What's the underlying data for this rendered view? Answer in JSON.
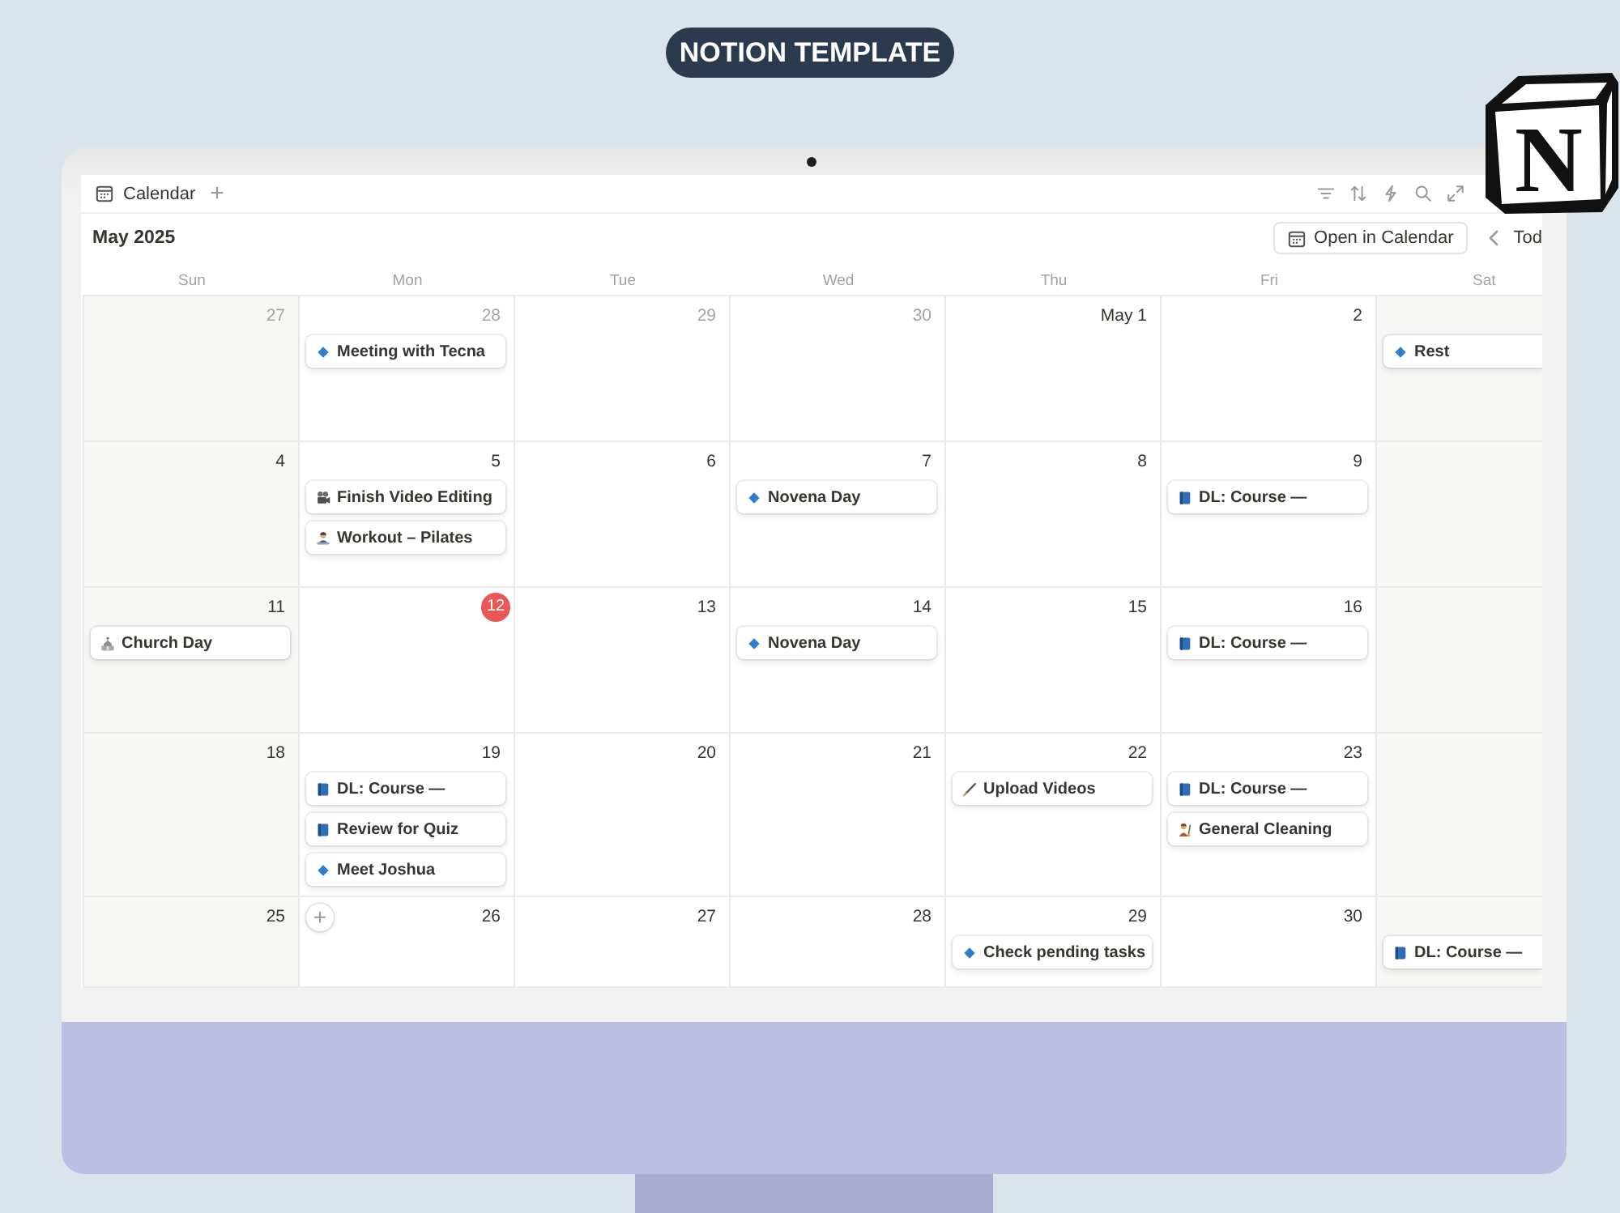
{
  "badge": {
    "label": "NOTION TEMPLATE"
  },
  "logo": {
    "letter": "N"
  },
  "app": {
    "view_tab": "Calendar",
    "add_view": "+",
    "month": "May 2025",
    "open_button": "Open in Calendar",
    "today_button": "Tod"
  },
  "weekdays": [
    "Sun",
    "Mon",
    "Tue",
    "Wed",
    "Thu",
    "Fri",
    "Sat"
  ],
  "weeks": [
    {
      "days": [
        {
          "date": "27",
          "muted": true,
          "today": false
        },
        {
          "date": "28",
          "muted": true,
          "today": false,
          "events": [
            {
              "title": "Meeting with Tecna",
              "kind": "diamond"
            }
          ]
        },
        {
          "date": "29",
          "muted": true,
          "today": false
        },
        {
          "date": "30",
          "muted": true,
          "today": false
        },
        {
          "date": "May 1",
          "muted": false,
          "today": false
        },
        {
          "date": "2",
          "muted": false,
          "today": false
        }
      ],
      "saturday": {
        "events": [
          {
            "title": "Rest",
            "kind": "diamond"
          }
        ]
      }
    },
    {
      "days": [
        {
          "date": "4",
          "muted": false,
          "today": false
        },
        {
          "date": "5",
          "muted": false,
          "today": false,
          "events": [
            {
              "title": "Finish Video Editing",
              "kind": "camera"
            },
            {
              "title": "Workout – Pilates",
              "kind": "person"
            }
          ]
        },
        {
          "date": "6",
          "muted": false,
          "today": false
        },
        {
          "date": "7",
          "muted": false,
          "today": false,
          "events": [
            {
              "title": "Novena Day",
              "kind": "diamond"
            }
          ]
        },
        {
          "date": "8",
          "muted": false,
          "today": false
        },
        {
          "date": "9",
          "muted": false,
          "today": false,
          "events": [
            {
              "title": "DL: Course —",
              "kind": "book"
            }
          ]
        }
      ]
    },
    {
      "days": [
        {
          "date": "11",
          "muted": false,
          "today": false,
          "events": [
            {
              "title": "Church Day",
              "kind": "church"
            }
          ]
        },
        {
          "date": "12",
          "muted": false,
          "today": true
        },
        {
          "date": "13",
          "muted": false,
          "today": false
        },
        {
          "date": "14",
          "muted": false,
          "today": false,
          "events": [
            {
              "title": "Novena Day",
              "kind": "diamond"
            }
          ]
        },
        {
          "date": "15",
          "muted": false,
          "today": false
        },
        {
          "date": "16",
          "muted": false,
          "today": false,
          "events": [
            {
              "title": "DL: Course —",
              "kind": "book"
            }
          ]
        }
      ]
    },
    {
      "days": [
        {
          "date": "18",
          "muted": false,
          "today": false
        },
        {
          "date": "19",
          "muted": false,
          "today": false,
          "events": [
            {
              "title": "DL: Course —",
              "kind": "book"
            },
            {
              "title": "Review for Quiz",
              "kind": "book"
            },
            {
              "title": "Meet Joshua",
              "kind": "diamond"
            }
          ]
        },
        {
          "date": "20",
          "muted": false,
          "today": false
        },
        {
          "date": "21",
          "muted": false,
          "today": false
        },
        {
          "date": "22",
          "muted": false,
          "today": false,
          "events": [
            {
              "title": "Upload Videos",
              "kind": "pencil"
            }
          ]
        },
        {
          "date": "23",
          "muted": false,
          "today": false,
          "events": [
            {
              "title": "DL: Course —",
              "kind": "book"
            },
            {
              "title": "General Cleaning",
              "kind": "cleaner"
            }
          ]
        }
      ]
    },
    {
      "days": [
        {
          "date": "25",
          "muted": false,
          "today": false
        },
        {
          "date": "26",
          "muted": false,
          "today": false,
          "add_button": "+"
        },
        {
          "date": "27",
          "muted": false,
          "today": false
        },
        {
          "date": "28",
          "muted": false,
          "today": false
        },
        {
          "date": "29",
          "muted": false,
          "today": false,
          "events": [
            {
              "title": "Check pending tasks",
              "kind": "diamond"
            }
          ]
        },
        {
          "date": "30",
          "muted": false,
          "today": false
        }
      ],
      "saturday": {
        "events": [
          {
            "title": "DL: Course —",
            "kind": "book"
          }
        ]
      }
    }
  ]
}
